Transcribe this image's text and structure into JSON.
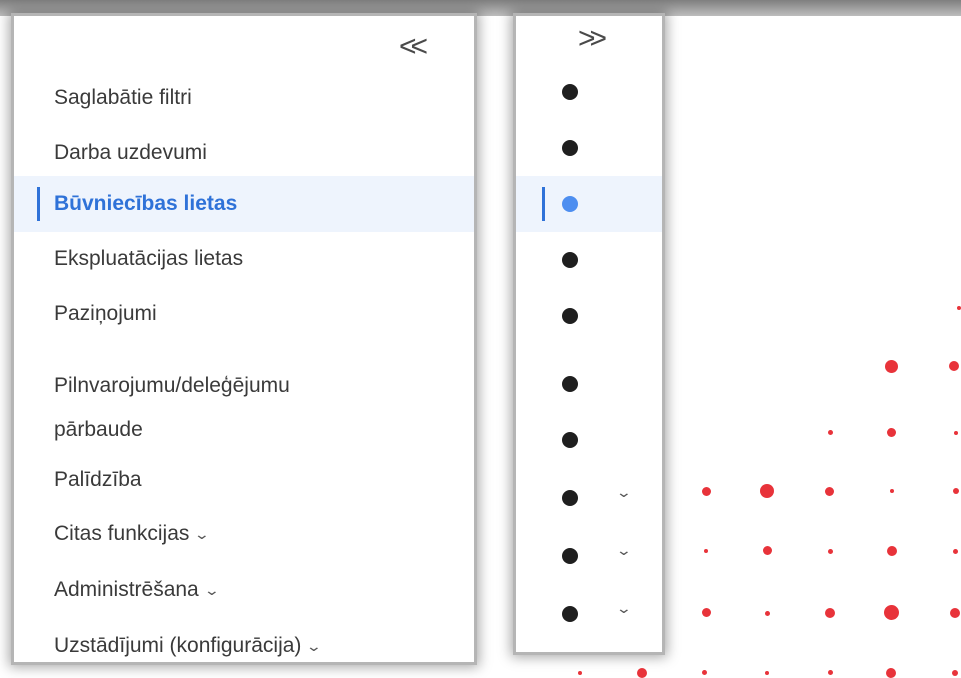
{
  "expanded_panel": {
    "collapse_icon": "double-chevron-left-icon",
    "collapse_glyph": "<<",
    "items": [
      {
        "label": "Saglabātie filtri"
      },
      {
        "label": "Darba uzdevumi"
      },
      {
        "label": "Būvniecības lietas",
        "active": true
      },
      {
        "label": "Ekspluatācijas lietas"
      },
      {
        "label": "Paziņojumi"
      },
      {
        "label_line1": "Pilnvarojumu/deleģējumu",
        "label_line2": "pārbaude"
      },
      {
        "label": "Palīdzība"
      },
      {
        "label": "Citas funkcijas",
        "has_submenu": true
      },
      {
        "label": "Administrēšana",
        "has_submenu": true
      },
      {
        "label": "Uzstādījumi (konfigurācija)",
        "has_submenu": true
      }
    ],
    "chevron_glyph": "⌄"
  },
  "collapsed_panel": {
    "expand_icon": "double-chevron-right-icon",
    "expand_glyph": ">>",
    "item_icon": "bullet-icon",
    "chevron_glyph": "⌄"
  },
  "colors": {
    "accent": "#2f72d8",
    "active_background": "#eef4fd",
    "active_bullet": "#4d8ef0",
    "bullet": "#1f1f1f",
    "decoration_dots": "#e8333a",
    "text": "#3a3a3a"
  }
}
